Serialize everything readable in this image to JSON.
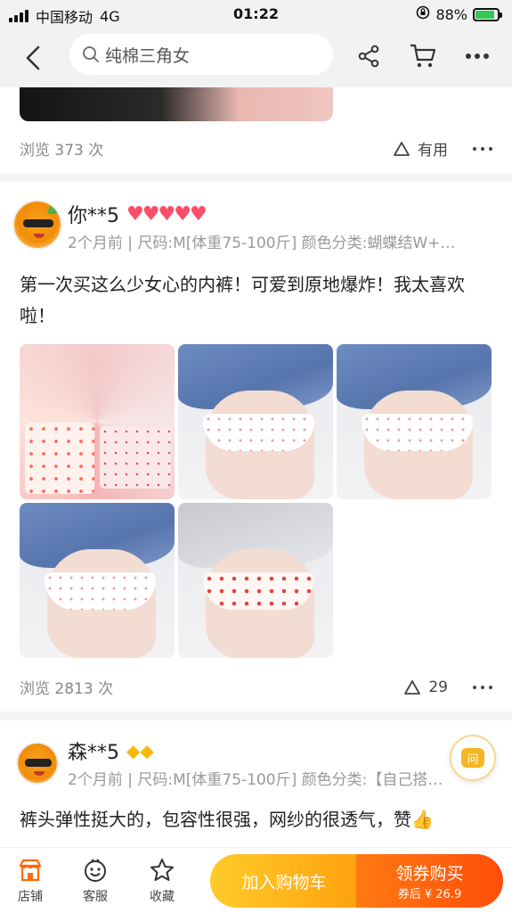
{
  "status_bar": {
    "carrier": "中国移动",
    "network": "4G",
    "time": "01:22",
    "battery": "88%"
  },
  "nav": {
    "search_placeholder": "纯棉三角女"
  },
  "prev_review": {
    "views": "浏览 373 次",
    "useful_label": "有用"
  },
  "reviews": [
    {
      "username": "你**5",
      "badge_icons": "heart-level-badges",
      "badge_count": 5,
      "meta": "2个月前 | 尺码:M[体重75-100斤] 颜色分类:蝴蝶结W+…",
      "text": "第一次买这么少女心的内裤！可爱到原地爆炸！我太喜欢啦！",
      "views": "浏览 2813 次",
      "likes": "29"
    },
    {
      "username": "森**5",
      "badge_icons": "diamond-level-badges",
      "badge_count": 2,
      "meta": "2个月前 | 尺码:M[体重75-100斤] 颜色分类:【自己搭…",
      "text": "裤头弹性挺大的，包容性很强，网纱的很透气，赞👍"
    }
  ],
  "ask_button": {
    "label": "问"
  },
  "bottom_bar": {
    "tabs": [
      {
        "label": "店铺",
        "icon": "store-icon"
      },
      {
        "label": "客服",
        "icon": "customer-service-icon"
      },
      {
        "label": "收藏",
        "icon": "star-icon"
      }
    ],
    "cart_button": "加入购物车",
    "buy_button": "领券购买",
    "buy_sub": "券后 ¥ 26.9"
  },
  "colors": {
    "accent_yellow": "#ffb31a",
    "accent_orange": "#ff5a0a",
    "store_icon": "#ff6a00"
  }
}
